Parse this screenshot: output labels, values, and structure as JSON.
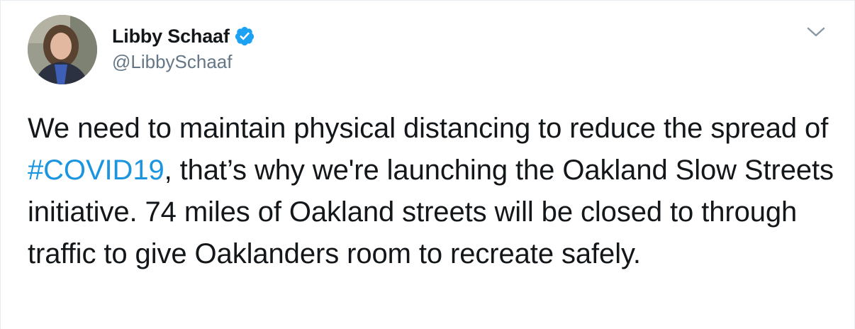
{
  "author": {
    "display_name": "Libby Schaaf",
    "handle": "@LibbySchaaf",
    "verified": true,
    "verified_icon": "verified-badge-icon",
    "avatar_icon": "profile-photo"
  },
  "menu": {
    "icon": "chevron-down-icon"
  },
  "tweet": {
    "text_part_1": "We need to maintain physical distancing to reduce the spread of ",
    "hashtag": "#COVID19",
    "text_part_2": ", that’s why we're launching the Oakland Slow Streets initiative. 74 miles of Oakland streets will be closed to through traffic to give Oaklanders room to recreate safely."
  },
  "colors": {
    "text": "#14171a",
    "secondary": "#657786",
    "link": "#1b95e0",
    "verified": "#1da1f2",
    "border": "#e6ecf0"
  }
}
